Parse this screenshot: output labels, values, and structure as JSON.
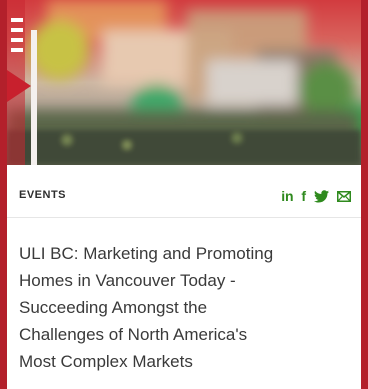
{
  "card": {
    "category": "EVENTS",
    "share": {
      "linkedin_label": "in",
      "facebook_label": "f",
      "icons": [
        "linkedin-icon",
        "facebook-icon",
        "twitter-icon",
        "email-icon"
      ],
      "icon_color": "#2f8a1e"
    },
    "title_lines": [
      "ULI BC: Marketing and Promoting",
      "Homes in Vancouver Today -",
      "Succeeding Amongst the",
      "Challenges of North America's",
      "Most Complex Markets"
    ]
  },
  "colors": {
    "page_background": "#b3202b",
    "card_background": "#ffffff",
    "title_text": "#3a3a3a"
  }
}
